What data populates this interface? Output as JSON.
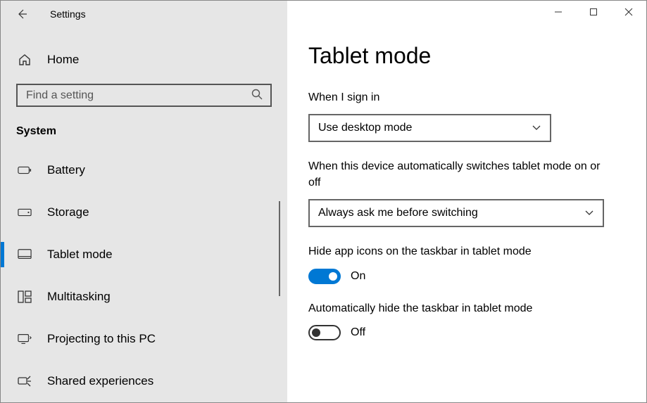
{
  "titlebar": {
    "app_title": "Settings"
  },
  "sidebar": {
    "home_label": "Home",
    "search_placeholder": "Find a setting",
    "category": "System",
    "items": [
      {
        "label": "Battery"
      },
      {
        "label": "Storage"
      },
      {
        "label": "Tablet mode"
      },
      {
        "label": "Multitasking"
      },
      {
        "label": "Projecting to this PC"
      },
      {
        "label": "Shared experiences"
      }
    ]
  },
  "main": {
    "title": "Tablet mode",
    "signin": {
      "label": "When I sign in",
      "value": "Use desktop mode"
    },
    "switch": {
      "label": "When this device automatically switches tablet mode on or off",
      "value": "Always ask me before switching"
    },
    "hide_icons": {
      "label": "Hide app icons on the taskbar in tablet mode",
      "state": "On"
    },
    "auto_hide": {
      "label": "Automatically hide the taskbar in tablet mode",
      "state": "Off"
    }
  }
}
